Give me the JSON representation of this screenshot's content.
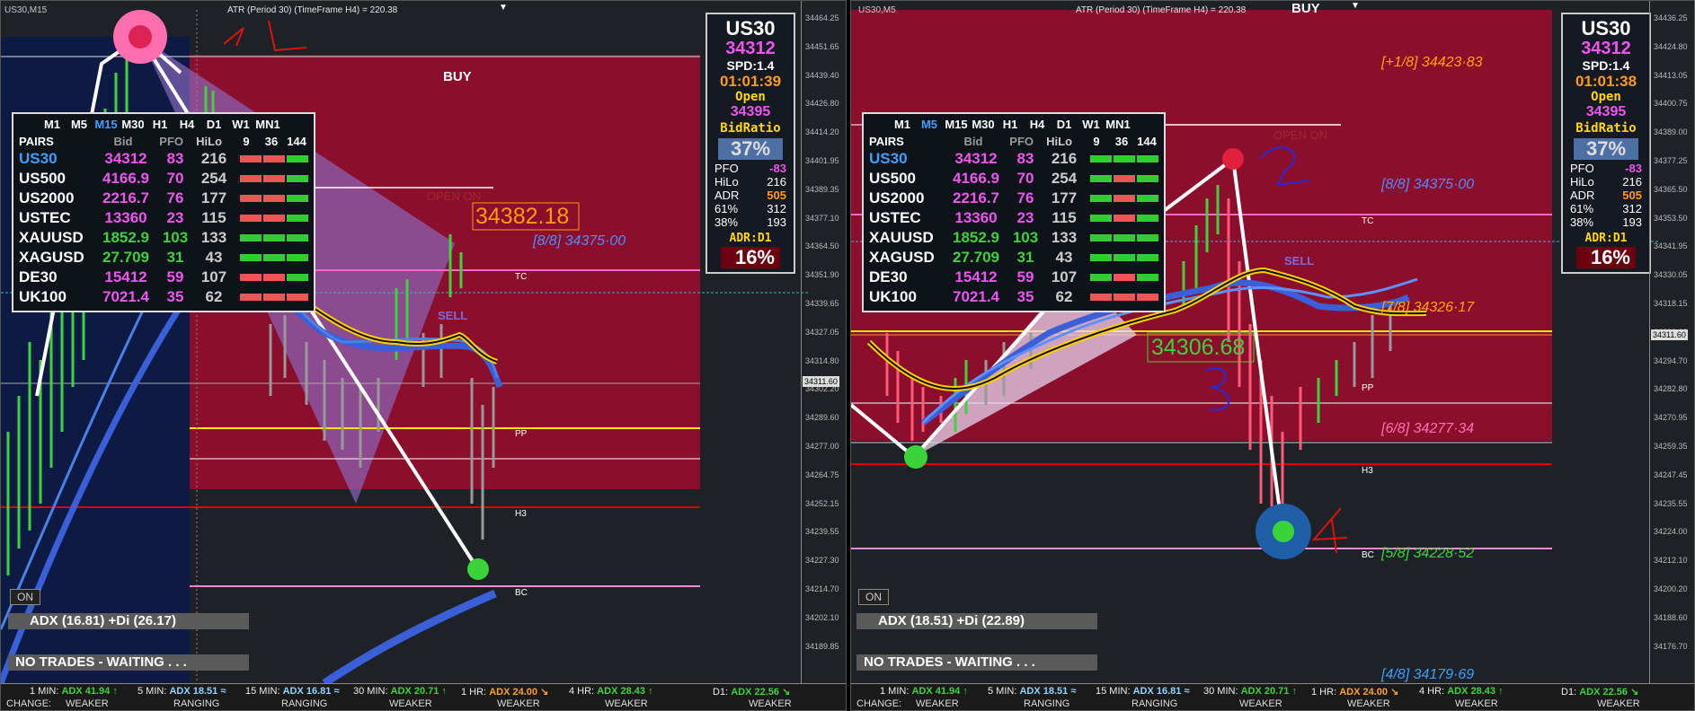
{
  "left": {
    "title": "US30,M15",
    "atr": "ATR (Period 30) (TimeFrame H4) = 220.38",
    "signal": "BUY",
    "sell_label": "SELL",
    "open_on": "OPEN ON",
    "price_box": "34382.18",
    "level_8_8": "[8/8]  34375·00",
    "tc": "TC",
    "pp": "PP",
    "h3": "H3",
    "bc": "BC",
    "annotation": "1 1",
    "current_price": "34311.60",
    "price_scale": [
      "34464.25",
      "34451.65",
      "34439.40",
      "34426.80",
      "34414.20",
      "34401.95",
      "34389.35",
      "34377.10",
      "34364.50",
      "34351.90",
      "34339.65",
      "34327.05",
      "34314.80",
      "34302.20",
      "34289.60",
      "34277.00",
      "34264.75",
      "34252.15",
      "34239.55",
      "34227.30",
      "34214.70",
      "34202.10",
      "34189.85"
    ],
    "on_button": "ON",
    "adx": "ADX (16.81)   +Di (26.17)",
    "no_trades": "NO TRADES - WAITING . . ."
  },
  "right": {
    "title": "US30,M5",
    "atr": "ATR (Period 30) (TimeFrame H4) = 220.38",
    "signal": "BUY",
    "sell_label": "SELL",
    "open_on": "OPEN ON",
    "price_box": "34306.68",
    "levels": [
      {
        "text": "[+1/8]  34423·83",
        "color": "#ffa500"
      },
      {
        "text": "[8/8]  34375·00",
        "color": "#4e8cff"
      },
      {
        "text": "[7/8]  34326·17",
        "color": "#ffa500"
      },
      {
        "text": "[6/8]  34277·34",
        "color": "#ff6fb0"
      },
      {
        "text": "[5/8]  34228·52",
        "color": "#3ad43a"
      },
      {
        "text": "[4/8]  34179·69",
        "color": "#3aa0ff"
      }
    ],
    "tc": "TC",
    "pp": "PP",
    "h3": "H3",
    "bc": "BC",
    "annotations": [
      "2",
      "3",
      "4"
    ],
    "current_price": "34311.60",
    "price_scale": [
      "34436.25",
      "34424.80",
      "34413.05",
      "34400.75",
      "34389.00",
      "34377.25",
      "34365.50",
      "34353.50",
      "34341.95",
      "34330.05",
      "34318.15",
      "34306.60",
      "34294.70",
      "34282.80",
      "34270.95",
      "34259.35",
      "34247.45",
      "34235.55",
      "34224.00",
      "34212.10",
      "34200.20",
      "34188.60",
      "34176.70"
    ],
    "on_button": "ON",
    "adx": "ADX (18.51)   +Di (22.89)",
    "no_trades": "NO TRADES - WAITING . . ."
  },
  "info_box": {
    "left": {
      "symbol": "US30",
      "bid": "34312",
      "spd": "SPD:1.4",
      "time": "01:01:39",
      "open_label": "Open",
      "open": "34395",
      "bidratio_label": "BidRatio",
      "ratio": "37%",
      "pfo_l": "PFO",
      "pfo_v": "-83",
      "hilo_l": "HiLo",
      "hilo_v": "216",
      "adr_l": "ADR",
      "adr_v": "505",
      "p61_l": "61%",
      "p61_v": "312",
      "p38_l": "38%",
      "p38_v": "193",
      "adr_label": "ADR:D1",
      "pct": "16%"
    },
    "right": {
      "symbol": "US30",
      "bid": "34312",
      "spd": "SPD:1.4",
      "time": "01:01:38",
      "open_label": "Open",
      "open": "34395",
      "bidratio_label": "BidRatio",
      "ratio": "37%",
      "pfo_l": "PFO",
      "pfo_v": "-83",
      "hilo_l": "HiLo",
      "hilo_v": "216",
      "adr_l": "ADR",
      "adr_v": "505",
      "p61_l": "61%",
      "p61_v": "312",
      "p38_l": "38%",
      "p38_v": "193",
      "adr_label": "ADR:D1",
      "pct": "16%"
    }
  },
  "pairs_table": {
    "timeframes": [
      "M1",
      "M5",
      "M15",
      "M30",
      "H1",
      "H4",
      "D1",
      "W1",
      "MN1"
    ],
    "headers": {
      "pairs": "PAIRS",
      "bid": "Bid",
      "pfo": "PFO",
      "hilo": "HiLo",
      "tf1": "9",
      "tf2": "36",
      "tf3": "144"
    },
    "rows": [
      {
        "name": "US30",
        "bid": "34312",
        "pfo": "83",
        "hilo": "216",
        "name_color": "#3aa0ff",
        "bid_color": "#ee55ee",
        "pfo_color": "#ee55ee"
      },
      {
        "name": "US500",
        "bid": "4166.9",
        "pfo": "70",
        "hilo": "254",
        "name_color": "#ffffff",
        "bid_color": "#ee55ee",
        "pfo_color": "#ee55ee"
      },
      {
        "name": "US2000",
        "bid": "2216.7",
        "pfo": "76",
        "hilo": "177",
        "name_color": "#ffffff",
        "bid_color": "#ee55ee",
        "pfo_color": "#ee55ee"
      },
      {
        "name": "USTEC",
        "bid": "13360",
        "pfo": "23",
        "hilo": "115",
        "name_color": "#ffffff",
        "bid_color": "#ee55ee",
        "pfo_color": "#ee55ee"
      },
      {
        "name": "XAUUSD",
        "bid": "1852.9",
        "pfo": "103",
        "hilo": "133",
        "name_color": "#ffffff",
        "bid_color": "#3ad43a",
        "pfo_color": "#3ad43a"
      },
      {
        "name": "XAGUSD",
        "bid": "27.709",
        "pfo": "31",
        "hilo": "43",
        "name_color": "#ffffff",
        "bid_color": "#3ad43a",
        "pfo_color": "#3ad43a"
      },
      {
        "name": "DE30",
        "bid": "15412",
        "pfo": "59",
        "hilo": "107",
        "name_color": "#ffffff",
        "bid_color": "#ee55ee",
        "pfo_color": "#ee55ee"
      },
      {
        "name": "UK100",
        "bid": "7021.4",
        "pfo": "35",
        "hilo": "62",
        "name_color": "#ffffff",
        "bid_color": "#ee55ee",
        "pfo_color": "#ee55ee"
      }
    ],
    "left_bars": [
      [
        "r",
        "r",
        "g"
      ],
      [
        "r",
        "r",
        "g"
      ],
      [
        "r",
        "r",
        "g"
      ],
      [
        "r",
        "r",
        "g"
      ],
      [
        "g",
        "g",
        "g"
      ],
      [
        "g",
        "g",
        "g"
      ],
      [
        "r",
        "r",
        "g"
      ],
      [
        "r",
        "r",
        "r"
      ]
    ],
    "right_bars": [
      [
        "g",
        "g",
        "g"
      ],
      [
        "g",
        "r",
        "g"
      ],
      [
        "g",
        "r",
        "g"
      ],
      [
        "g",
        "r",
        "g"
      ],
      [
        "g",
        "g",
        "g"
      ],
      [
        "g",
        "g",
        "g"
      ],
      [
        "g",
        "r",
        "g"
      ],
      [
        "r",
        "r",
        "r"
      ]
    ]
  },
  "bottom": {
    "change_label": "CHANGE:",
    "cells": [
      {
        "label": "1 MIN:",
        "adx": "ADX 41.94",
        "arrow": "↑",
        "color": "green",
        "status": "WEAKER"
      },
      {
        "label": "5 MIN:",
        "adx": "ADX 18.51",
        "arrow": "≈",
        "color": "blue",
        "status": "RANGING"
      },
      {
        "label": "15 MIN:",
        "adx": "ADX 16.81",
        "arrow": "≈",
        "color": "blue",
        "status": "RANGING"
      },
      {
        "label": "30 MIN:",
        "adx": "ADX 20.71",
        "arrow": "↑",
        "color": "green",
        "status": "WEAKER"
      },
      {
        "label": "1 HR:",
        "adx": "ADX 24.00",
        "arrow": "↘",
        "color": "orange",
        "status": "WEAKER"
      },
      {
        "label": "4 HR:",
        "adx": "ADX 28.43",
        "arrow": "↑",
        "color": "green",
        "status": "WEAKER"
      },
      {
        "label": "D1:",
        "adx": "ADX 22.56",
        "arrow": "↘",
        "color": "green",
        "status": "WEAKER"
      }
    ]
  }
}
